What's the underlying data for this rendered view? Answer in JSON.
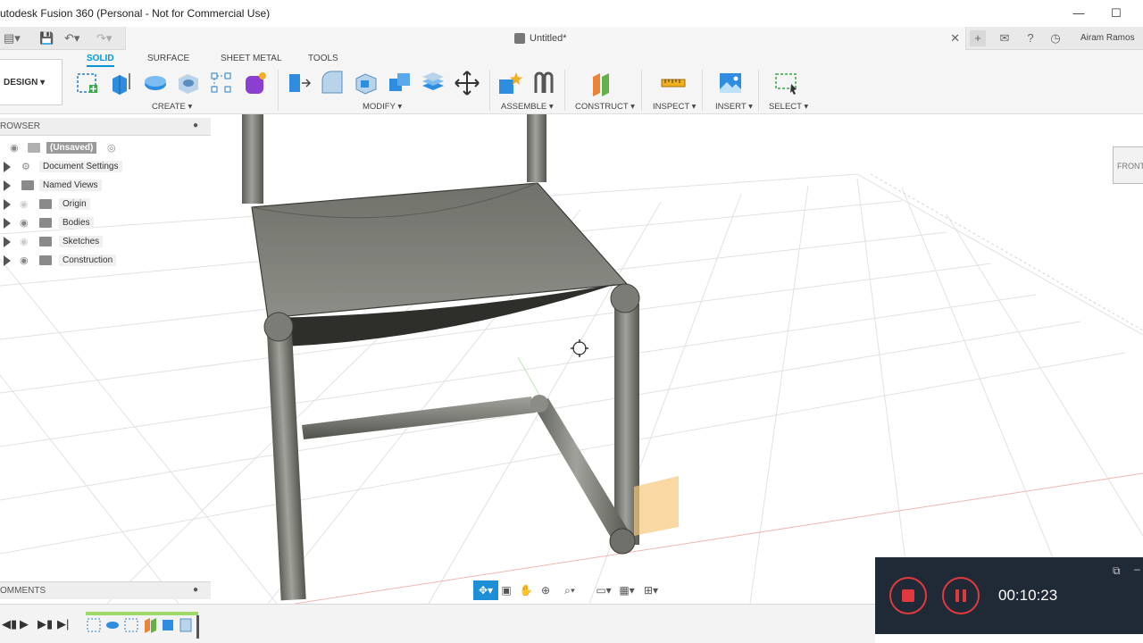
{
  "window": {
    "title": "utodesk Fusion 360 (Personal - Not for Commercial Use)"
  },
  "tabbar": {
    "document_title": "Untitled*",
    "user_name": "Airam Ramos"
  },
  "toolbar": {
    "workspace": "DESIGN",
    "tabs": [
      "SOLID",
      "SURFACE",
      "SHEET METAL",
      "TOOLS"
    ],
    "groups": {
      "create": "CREATE",
      "modify": "MODIFY",
      "assemble": "ASSEMBLE",
      "construct": "CONSTRUCT",
      "inspect": "INSPECT",
      "insert": "INSERT",
      "select": "SELECT"
    }
  },
  "browser": {
    "header": "ROWSER",
    "root": "(Unsaved)",
    "nodes": [
      "Document Settings",
      "Named Views",
      "Origin",
      "Bodies",
      "Sketches",
      "Construction"
    ]
  },
  "comments": {
    "header": "OMMENTS"
  },
  "viewcube": {
    "face_label": "FRONT"
  },
  "recorder": {
    "elapsed": "00:10:23"
  },
  "colors": {
    "accent": "#0696d7",
    "recorder_bg": "#1f2a36",
    "record_red": "#e03a3e",
    "chair_metal": "#7d7f78"
  }
}
